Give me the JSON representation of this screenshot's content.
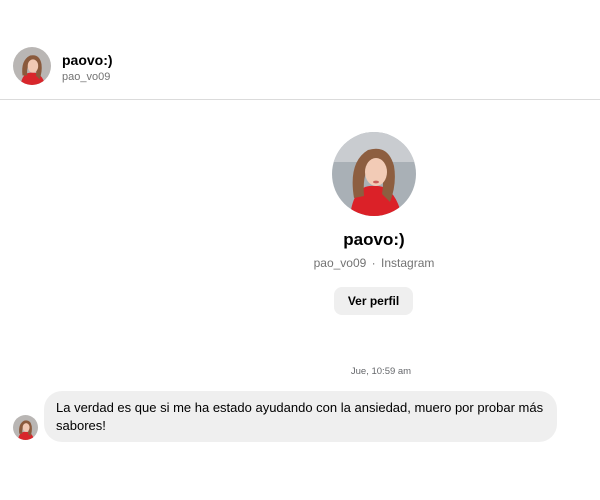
{
  "header": {
    "display_name": "paovo:)",
    "username": "pao_vo09"
  },
  "profile": {
    "display_name": "paovo:)",
    "username": "pao_vo09",
    "separator": "·",
    "platform": "Instagram",
    "view_profile_label": "Ver perfil"
  },
  "conversation": {
    "timestamp": "Jue, 10:59 am",
    "messages": [
      {
        "text": "La verdad es que si me ha estado ayudando con la ansiedad, muero por probar más sabores!"
      }
    ]
  },
  "colors": {
    "bubble_bg": "#efefef",
    "muted_text": "#737373",
    "divider": "#dbdbdb"
  }
}
